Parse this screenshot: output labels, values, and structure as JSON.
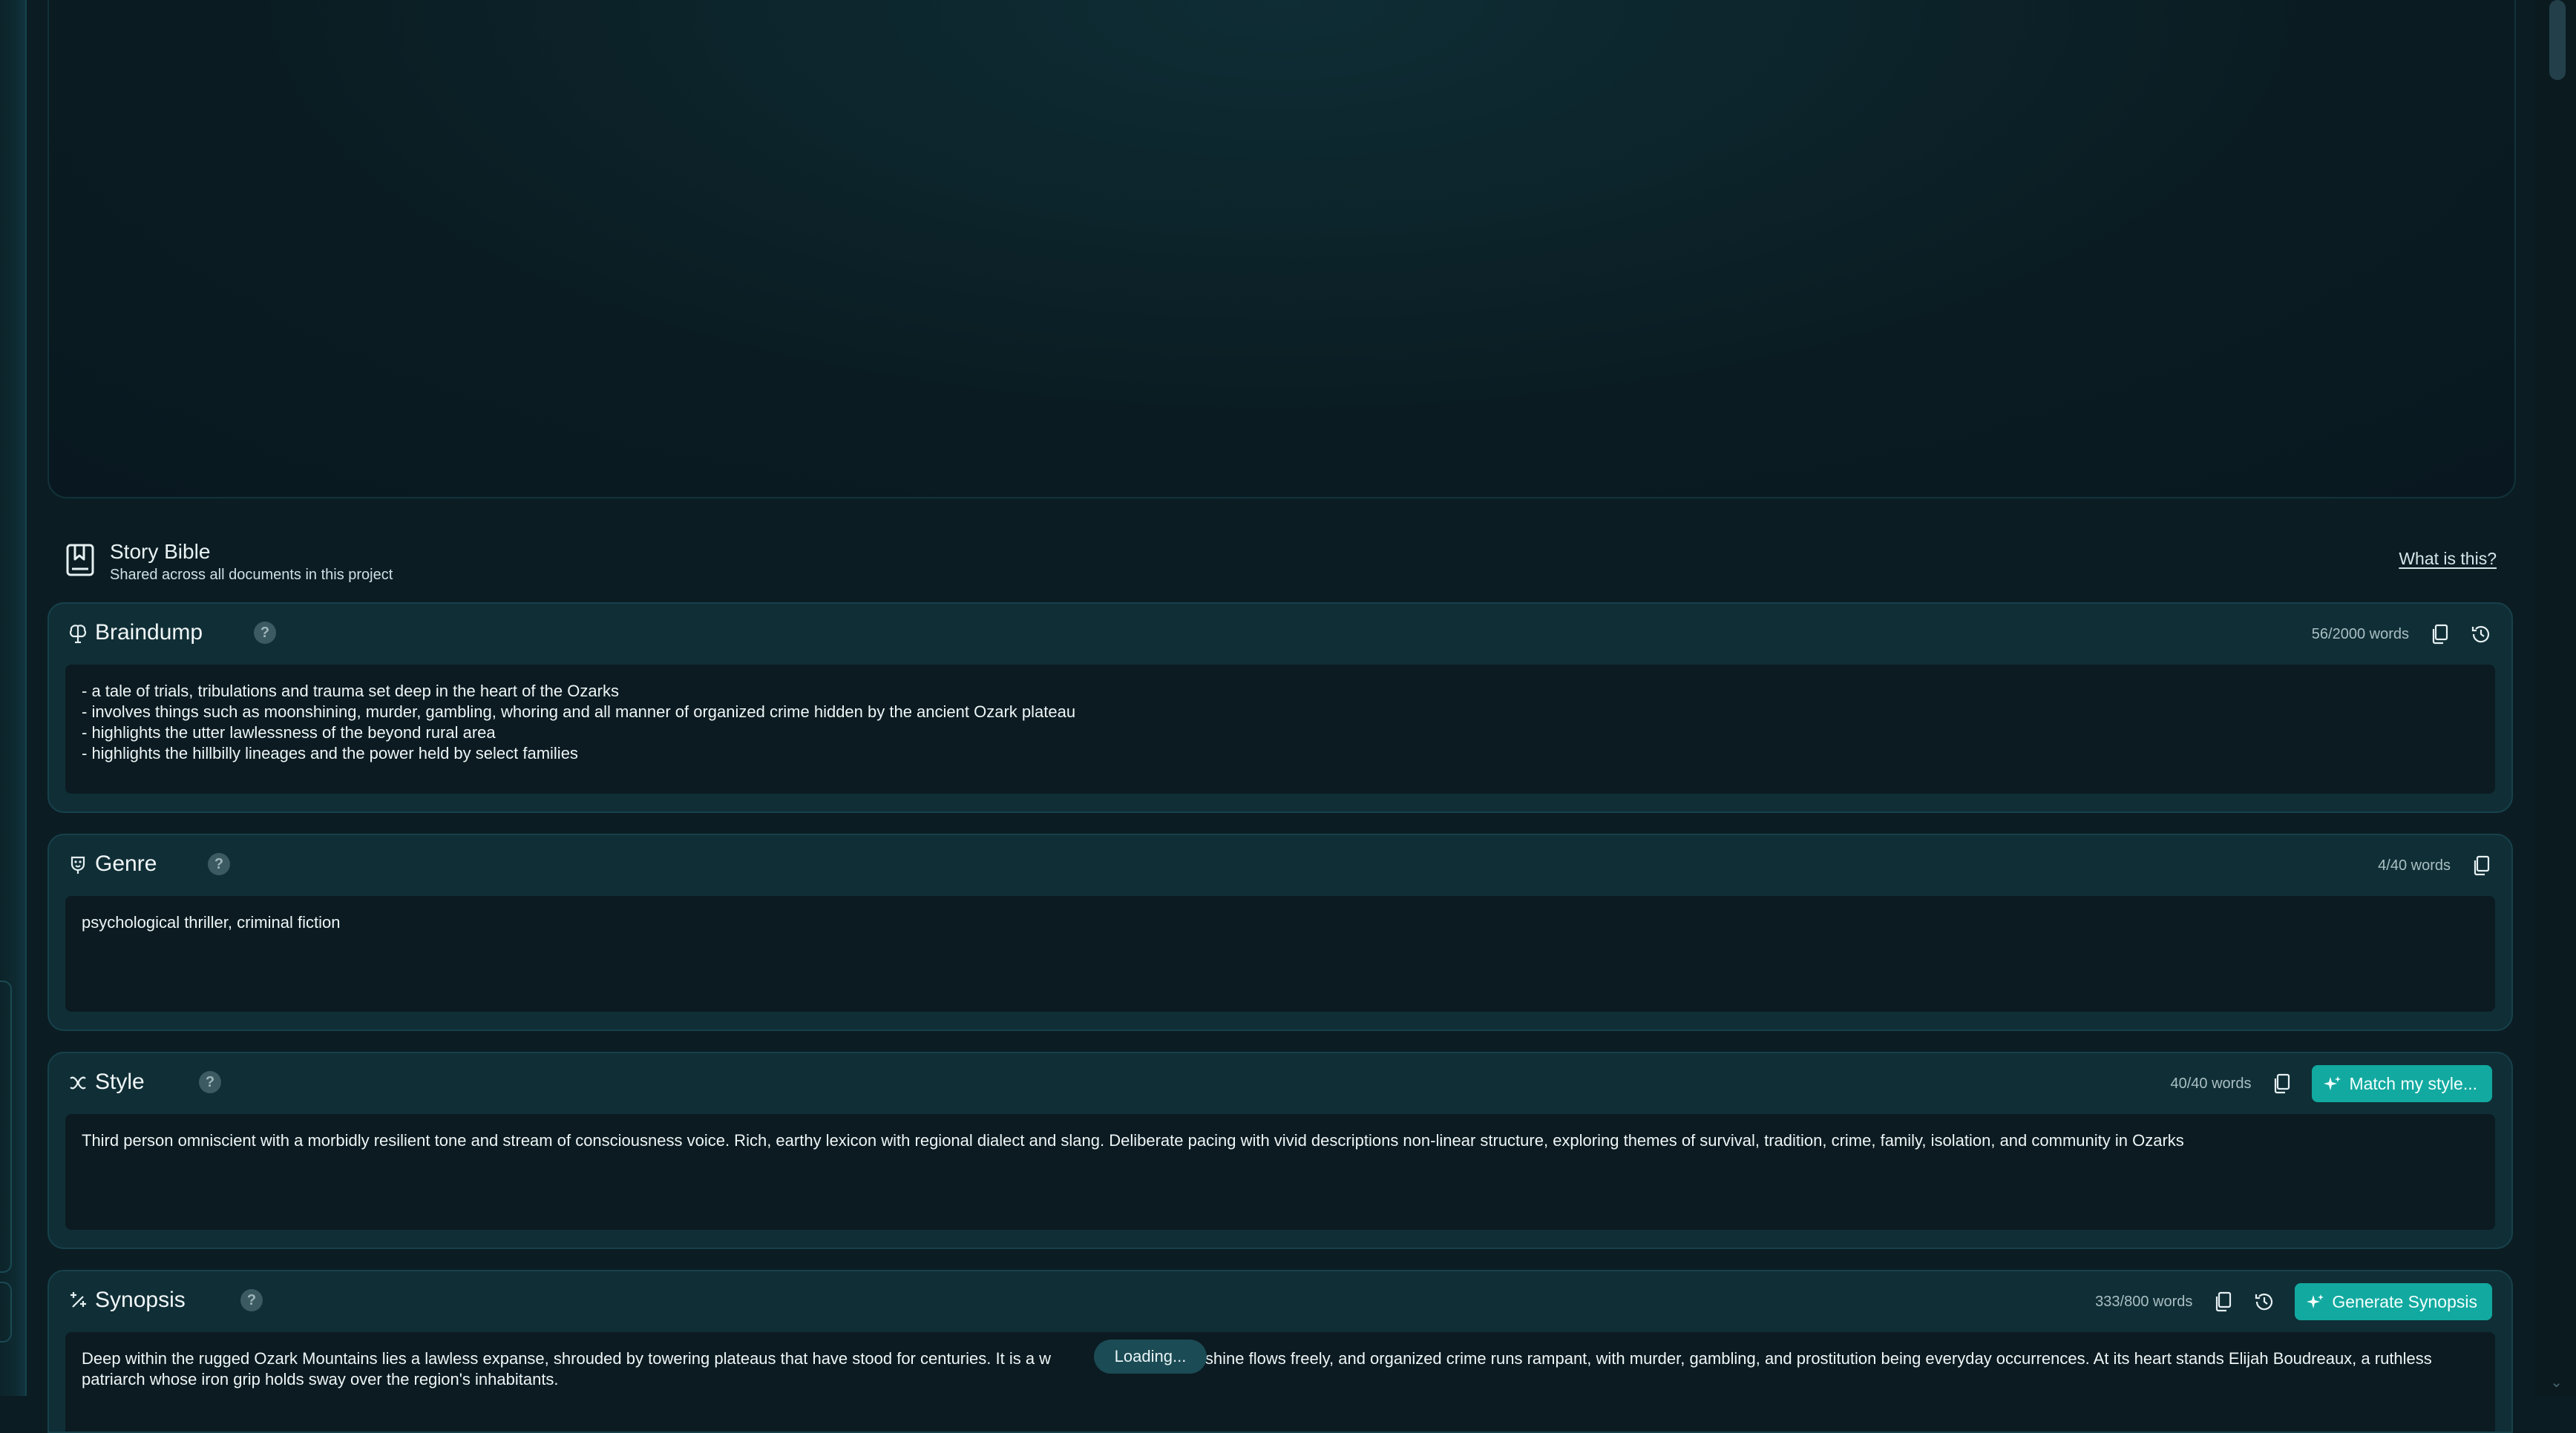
{
  "story_bible": {
    "title": "Story Bible",
    "subtitle": "Shared across all documents in this project",
    "help_link": "What is this?",
    "help_badge": "?"
  },
  "braindump": {
    "title": "Braindump",
    "word_count": "56/2000 words",
    "text": "- a tale of trials, tribulations and trauma set deep in the heart of the Ozarks\n- involves things such as moonshining, murder, gambling, whoring and all manner of organized crime hidden by the ancient Ozark plateau\n- highlights the utter lawlessness of the beyond rural area\n- highlights the hillbilly lineages and the power held by select families"
  },
  "genre": {
    "title": "Genre",
    "word_count": "4/40 words",
    "text": "psychological thriller, criminal fiction"
  },
  "style": {
    "title": "Style",
    "word_count": "40/40 words",
    "button": "Match my style...",
    "text": "Third person omniscient with a morbidly resilient tone and stream of consciousness voice. Rich, earthy lexicon with regional dialect and slang. Deliberate pacing with vivid descriptions non-linear structure, exploring themes of survival, tradition, crime, family, isolation, and community in Ozarks"
  },
  "synopsis": {
    "title": "Synopsis",
    "word_count": "333/800 words",
    "button": "Generate Synopsis",
    "text": "Deep within the rugged Ozark Mountains lies a lawless expanse, shrouded by towering plateaus that have stood for centuries. It is a w                         moonshine flows freely, and organized crime runs rampant, with murder, gambling, and prostitution being everyday occurrences. At its heart stands Elijah Boudreaux, a ruthless patriarch whose iron grip holds sway over the region's inhabitants.",
    "loading": "Loading..."
  },
  "icons": {
    "story_bible": "book-bookmark-icon",
    "braindump": "brain-icon",
    "genre": "drama-masks-icon",
    "style": "palette-icon",
    "synopsis": "sparkles-icon",
    "copy": "copy-icon",
    "history": "history-icon"
  },
  "colors": {
    "accent": "#12a9a0",
    "card": "#102e36",
    "field": "#0b1b21",
    "page": "#0b1d23"
  }
}
